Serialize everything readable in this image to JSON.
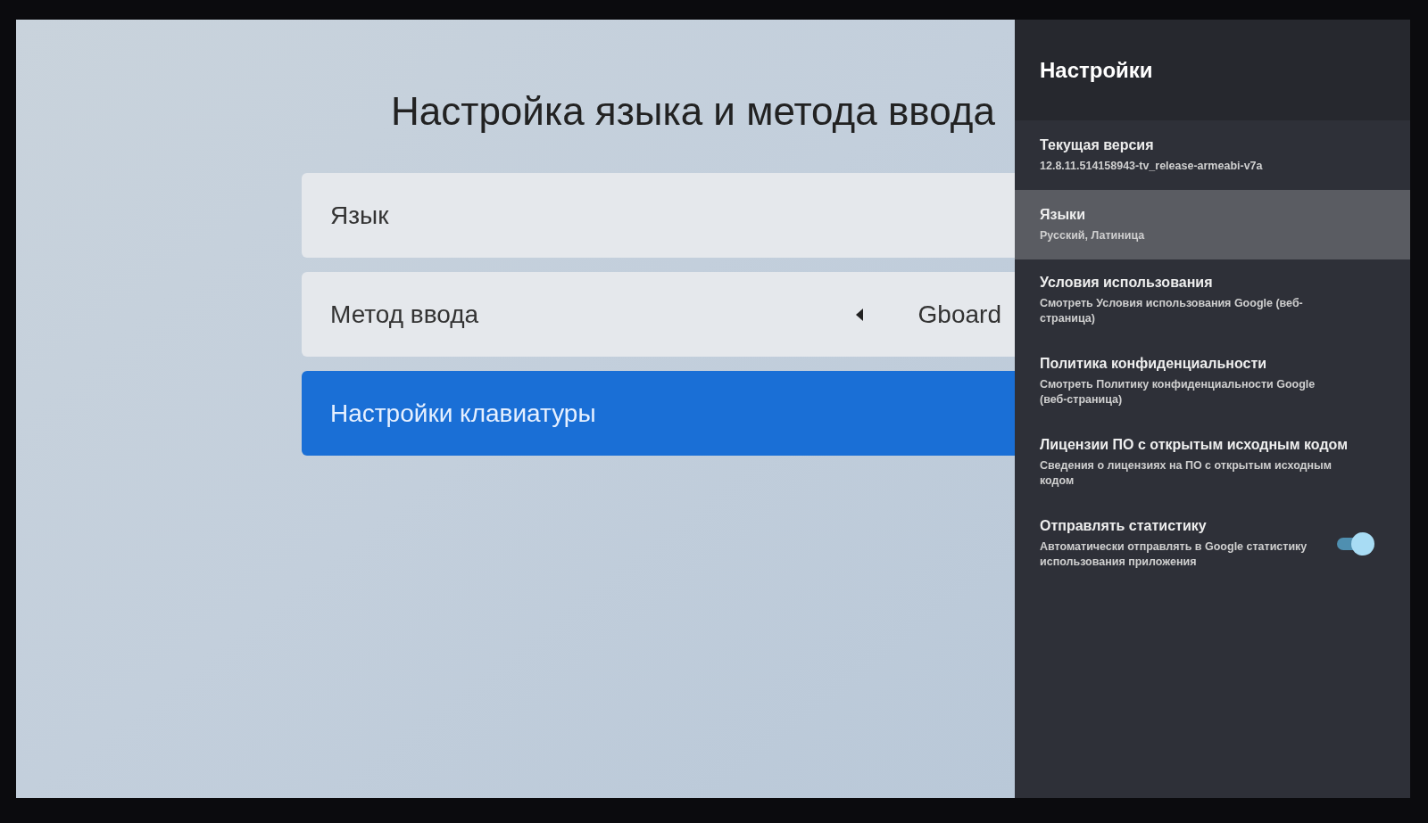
{
  "page": {
    "title": "Настройка языка и метода ввода",
    "items": [
      {
        "kind": "plain",
        "label": "Язык",
        "selected": false
      },
      {
        "kind": "selector",
        "label": "Метод ввода",
        "value": "Gboard",
        "selected": false
      },
      {
        "kind": "plain",
        "label": "Настройки клавиатуры",
        "selected": true
      }
    ]
  },
  "settings_panel": {
    "title": "Настройки",
    "items": [
      {
        "kind": "info",
        "title": "Текущая версия",
        "subtitle": "12.8.11.514158943-tv_release-armeabi-v7a",
        "selected": false
      },
      {
        "kind": "info",
        "title": "Языки",
        "subtitle": "Русский, Латиница",
        "selected": true
      },
      {
        "kind": "info",
        "title": "Условия использования",
        "subtitle": "Смотреть Условия использования Google (веб-страница)",
        "selected": false
      },
      {
        "kind": "info",
        "title": "Политика конфиденциальности",
        "subtitle": "Смотреть Политику конфиденциальности Google (веб-страница)",
        "selected": false
      },
      {
        "kind": "info",
        "title": "Лицензии ПО с открытым исходным кодом",
        "subtitle": "Сведения о лицензиях на ПО с открытым исходным кодом",
        "selected": false
      },
      {
        "kind": "toggle",
        "title": "Отправлять статистику",
        "subtitle": "Автоматически отправлять в Google статистику использования приложения",
        "on": true,
        "selected": false
      }
    ]
  }
}
